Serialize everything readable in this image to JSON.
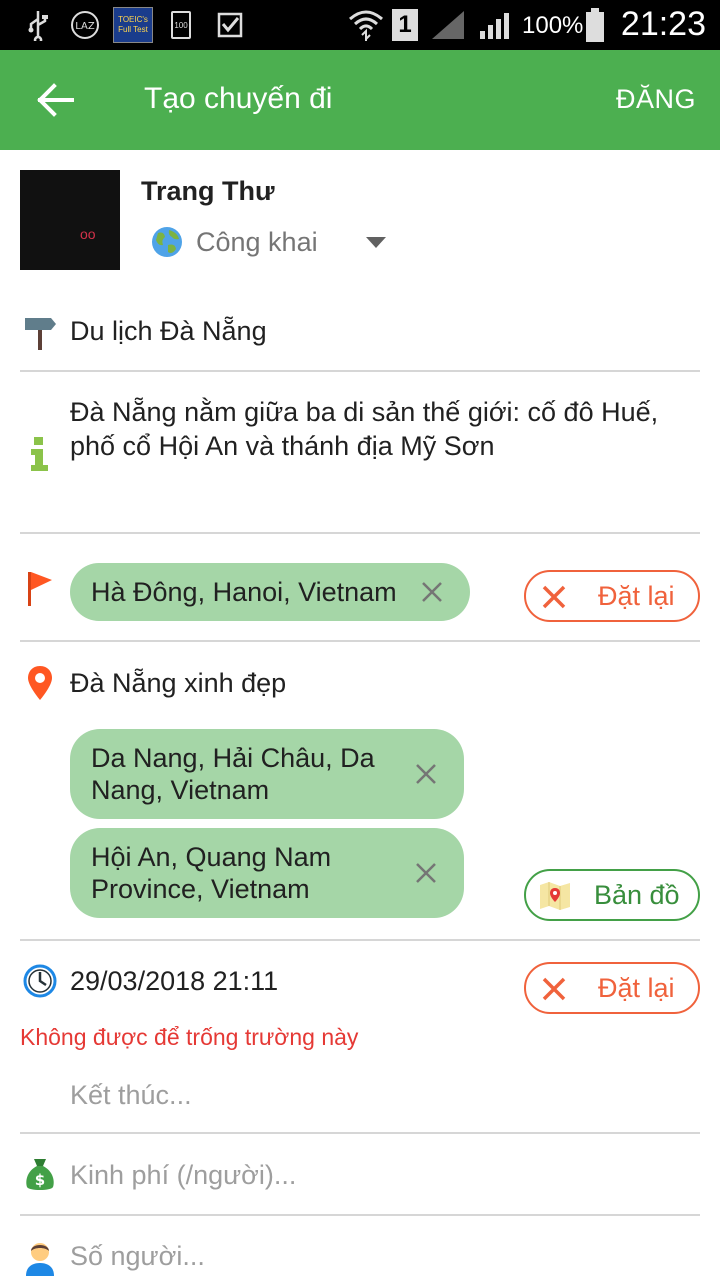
{
  "status_bar": {
    "toeic_badge": "TOEIC's Full Test",
    "battery_small": "100",
    "sim_slot": "1",
    "battery_percent": "100%",
    "time": "21:23",
    "lazada": "LAZ"
  },
  "app_bar": {
    "title": "Tạo chuyến đi",
    "post_label": "ĐĂNG"
  },
  "profile": {
    "name": "Trang Thư",
    "privacy": "Công khai"
  },
  "trip": {
    "name": "Du lịch Đà Nẵng",
    "description": "Đà Nẵng nằm giữa ba di sản thế giới: cố đô Huế, phố cổ Hội An và thánh địa Mỹ Sơn",
    "origin": {
      "chip": "Hà Đông, Hanoi, Vietnam",
      "reset_label": "Đặt lại"
    },
    "destination": {
      "title": "Đà Nẵng xinh đẹp",
      "chips": [
        "Da Nang, Hải Châu, Da Nang, Vietnam",
        "Hội An, Quang Nam Province, Vietnam"
      ],
      "chip_lines": [
        [
          "Da Nang, Hải Châu, Da",
          "Nang, Vietnam"
        ],
        [
          "Hội An, Quang Nam",
          "Province, Vietnam"
        ]
      ],
      "map_label": "Bản đồ"
    },
    "start_time": {
      "value": "29/03/2018 21:11",
      "reset_label": "Đặt lại",
      "error": "Không được để trống trường này"
    },
    "end_placeholder": "Kết thúc...",
    "budget_placeholder": "Kinh phí (/người)...",
    "people_placeholder": "Số người..."
  },
  "colors": {
    "primary": "#4caf50",
    "chip": "#a5d6a7",
    "reset": "#f0623c",
    "map_border": "#43a047",
    "error": "#e53935"
  }
}
